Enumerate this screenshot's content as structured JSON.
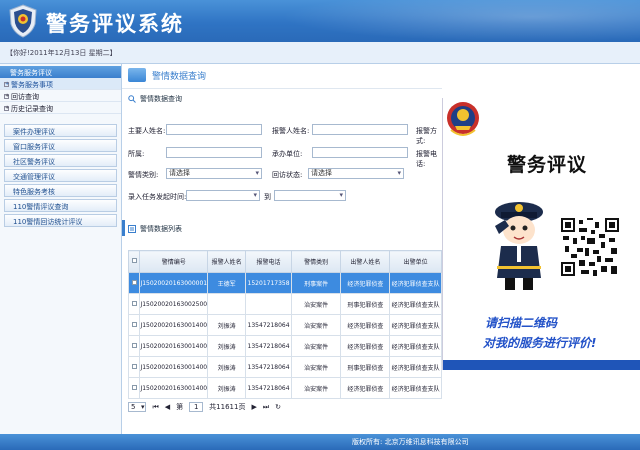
{
  "header": {
    "title": "警务评议系统"
  },
  "subbar": {
    "date": "【你好!2011年12月13日 星期二】"
  },
  "sidebar": {
    "head": "警务服务评议",
    "subs": [
      "警务服务事项",
      "回访查询",
      "历史记录查询"
    ],
    "buttons": [
      "案件办理评议",
      "窗口服务评议",
      "社区警务评议",
      "交通管理评议",
      "特色服务考核",
      "110警情评议查询",
      "110警情回访统计评议"
    ]
  },
  "main": {
    "title": "警情数据查询",
    "section": "警情数据查询",
    "form": {
      "f1": "主要人姓名:",
      "f2": "报警人姓名:",
      "f3": "报警方式:",
      "f4": "所属:",
      "f5": "承办单位:",
      "f6": "报警电话:",
      "f7": "警情类别:",
      "f8": "回访状态:",
      "f9": "录入任务发起时间:",
      "to": "到",
      "select_placeholder": "请选择"
    },
    "list_title": "警情数据列表"
  },
  "table": {
    "headers": [
      "警情编号",
      "报警人姓名",
      "报警电话",
      "警情类别",
      "出警人姓名",
      "出警单位"
    ],
    "rows": [
      [
        "J15020020163000001",
        "王德军",
        "15201717358",
        "刑事案件",
        "经济犯罪侦查",
        "经济犯罪侦查支队"
      ],
      [
        "J15020020163002500",
        "",
        "",
        "治安案件",
        "刑事犯罪侦查",
        "经济犯罪侦查支队"
      ],
      [
        "J15020020163001400",
        "刘振涛",
        "13547218064",
        "治安案件",
        "经济犯罪侦查",
        "经济犯罪侦查支队"
      ],
      [
        "J15020020163001400",
        "刘振涛",
        "13547218064",
        "治安案件",
        "经济犯罪侦查",
        "经济犯罪侦查支队"
      ],
      [
        "J15020020163001400",
        "刘振涛",
        "13547218064",
        "治安案件",
        "刑事犯罪侦查",
        "经济犯罪侦查支队"
      ],
      [
        "J15020020163001400",
        "刘振涛",
        "13547218064",
        "治安案件",
        "经济犯罪侦查",
        "经济犯罪侦查支队"
      ]
    ]
  },
  "pager": {
    "size": "5",
    "page_prefix": "第",
    "page": "1",
    "page_suffix": "共11611页"
  },
  "popup": {
    "title": "警务评议",
    "line1": "请扫描二维码",
    "line2": "对我的服务进行评价!"
  },
  "footer": {
    "text": "版权所有: 北京万维讯息科技有限公司"
  },
  "colors": {
    "header_blue": "#2f74c4",
    "selected_row": "#3d8be0",
    "popup_text": "#2352c8"
  }
}
